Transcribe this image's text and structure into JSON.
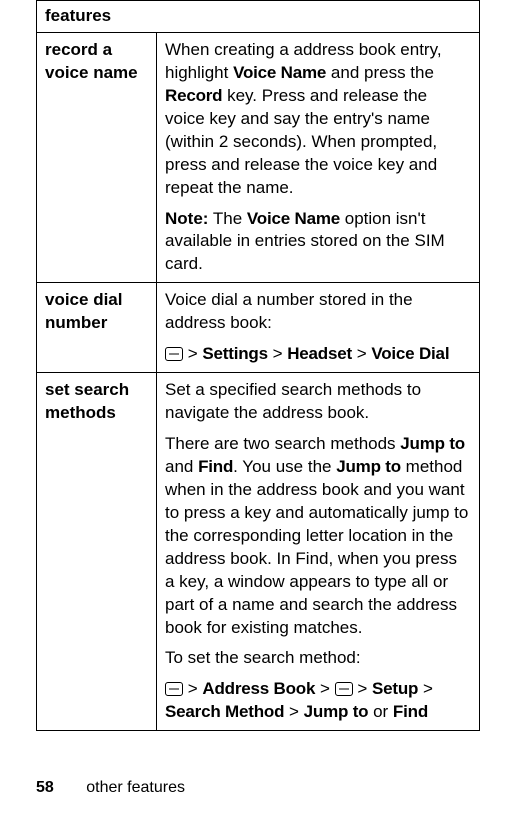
{
  "table": {
    "header": "features",
    "rows": [
      {
        "feature": "record a voice name",
        "paras": [
          {
            "type": "plain",
            "segments": [
              {
                "t": "When creating a address book entry, highlight "
              },
              {
                "t": "Voice Name",
                "cls": "narrow"
              },
              {
                "t": " and press the "
              },
              {
                "t": "Record",
                "cls": "narrow"
              },
              {
                "t": " key. Press and release the voice key and say the entry's name (within 2 seconds). When prompted, press and release the voice key and repeat the name."
              }
            ]
          },
          {
            "type": "plain",
            "segments": [
              {
                "t": "Note:",
                "cls": "bold"
              },
              {
                "t": " The "
              },
              {
                "t": "Voice Name",
                "cls": "narrow"
              },
              {
                "t": " option isn't available in entries stored on the SIM card."
              }
            ]
          }
        ]
      },
      {
        "feature": "voice dial number",
        "paras": [
          {
            "type": "plain",
            "segments": [
              {
                "t": "Voice dial a number stored in the address book:"
              }
            ]
          },
          {
            "type": "path",
            "segments": [
              {
                "icon": "menu-key"
              },
              {
                "t": " > "
              },
              {
                "t": "Settings",
                "cls": "narrow"
              },
              {
                "t": " > "
              },
              {
                "t": "Headset",
                "cls": "narrow"
              },
              {
                "t": " > "
              },
              {
                "t": "Voice Dial",
                "cls": "narrow"
              }
            ]
          }
        ]
      },
      {
        "feature": "set search methods",
        "paras": [
          {
            "type": "plain",
            "segments": [
              {
                "t": "Set a specified search methods to navigate the address book."
              }
            ]
          },
          {
            "type": "plain",
            "segments": [
              {
                "t": "There are two search methods "
              },
              {
                "t": "Jump to",
                "cls": "narrow"
              },
              {
                "t": " and "
              },
              {
                "t": "Find",
                "cls": "narrow"
              },
              {
                "t": ". You use the "
              },
              {
                "t": "Jump to",
                "cls": "narrow"
              },
              {
                "t": " method when in the address book and you want to press a key and automatically jump to the corresponding letter location in the address book. In Find, when you press a key, a window appears to type all or part of a name and search the address book for existing matches."
              }
            ]
          },
          {
            "type": "plain",
            "segments": [
              {
                "t": "To set the search method:"
              }
            ]
          },
          {
            "type": "path",
            "segments": [
              {
                "icon": "menu-key"
              },
              {
                "t": " > "
              },
              {
                "t": "Address Book",
                "cls": "narrow"
              },
              {
                "t": " > "
              },
              {
                "icon": "menu-key"
              },
              {
                "t": " > "
              },
              {
                "t": "Setup",
                "cls": "narrow"
              },
              {
                "t": " > "
              },
              {
                "t": "Search Method",
                "cls": "narrow"
              },
              {
                "t": " > "
              },
              {
                "t": "Jump to",
                "cls": "narrow"
              },
              {
                "t": " or  "
              },
              {
                "t": "Find",
                "cls": "narrow"
              }
            ]
          }
        ]
      }
    ]
  },
  "footer": {
    "page": "58",
    "section": "other features"
  }
}
